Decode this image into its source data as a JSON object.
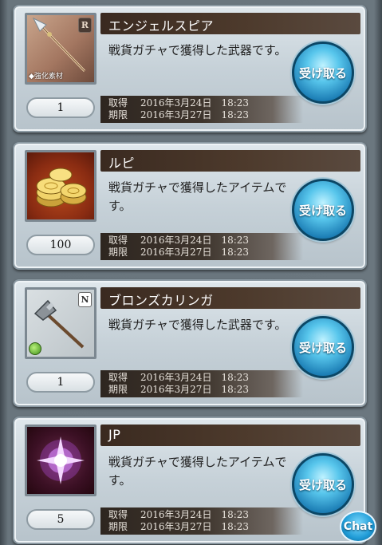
{
  "items": [
    {
      "name": "エンジェルスピア",
      "description": "戦貨ガチャで獲得した武器です。",
      "quantity": "1",
      "acquired_label": "取得",
      "acquired": "2016年3月24日　18:23",
      "expires_label": "期限",
      "expires": "2016年3月27日　18:23",
      "rarity": "R",
      "tag": "◆強化素材",
      "icon": "spear-icon",
      "button": "受け取る"
    },
    {
      "name": "ルピ",
      "description": "戦貨ガチャで獲得したアイテムです。",
      "quantity": "100",
      "acquired_label": "取得",
      "acquired": "2016年3月24日　18:23",
      "expires_label": "期限",
      "expires": "2016年3月27日　18:23",
      "icon": "gold-coins-icon",
      "button": "受け取る"
    },
    {
      "name": "ブロンズカリンガ",
      "description": "戦貨ガチャで獲得した武器です。",
      "quantity": "1",
      "acquired_label": "取得",
      "acquired": "2016年3月24日　18:23",
      "expires_label": "期限",
      "expires": "2016年3月27日　18:23",
      "rarity": "N",
      "icon": "axe-icon",
      "element_icon": "wind-element-icon",
      "button": "受け取る"
    },
    {
      "name": "JP",
      "description": "戦貨ガチャで獲得したアイテムです。",
      "quantity": "5",
      "acquired_label": "取得",
      "acquired": "2016年3月24日　18:23",
      "expires_label": "期限",
      "expires": "2016年3月27日　18:23",
      "icon": "jp-crystal-icon",
      "button": "受け取る"
    }
  ],
  "chat_button": "Chat",
  "colors": {
    "claim_button": "#2a98d0",
    "title_bar": "#3f2e24",
    "card": "#d4dde3"
  }
}
